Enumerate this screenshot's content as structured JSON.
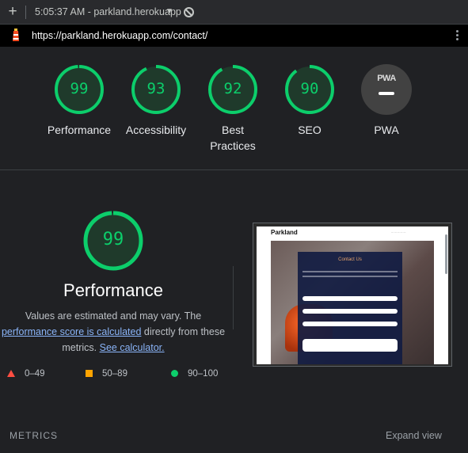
{
  "toolbar": {
    "new_tab_glyph": "+",
    "timestamp": "5:05:37 AM - parkland.herokuapp",
    "dropdown_glyph": "▼"
  },
  "urlbar": {
    "url": "https://parkland.herokuapp.com/contact/"
  },
  "categories": [
    {
      "label": "Performance",
      "score": "99",
      "fraction": 0.99
    },
    {
      "label": "Accessibility",
      "score": "93",
      "fraction": 0.93
    },
    {
      "label": "Best Practices",
      "score": "92",
      "fraction": 0.92
    },
    {
      "label": "SEO",
      "score": "90",
      "fraction": 0.9
    },
    {
      "label": "PWA",
      "badge": "PWA"
    }
  ],
  "performance": {
    "score": "99",
    "fraction": 0.99,
    "title": "Performance",
    "desc_1": "Values are estimated and may vary. The",
    "link_1": "performance score is calculated",
    "desc_2": " directly from these",
    "desc_3": "metrics. ",
    "link_2": "See calculator."
  },
  "legend": {
    "fail": "0–49",
    "average": "50–89",
    "pass": "90–100"
  },
  "thumbnail": {
    "brand": "Parkland",
    "form_title": "Contact Us"
  },
  "footer": {
    "metrics_label": "METRICS",
    "expand_label": "Expand view"
  },
  "colors": {
    "pass": "#0cce6b",
    "average": "#ffa400",
    "fail": "#ff4e42",
    "link": "#8ab4f8"
  },
  "icons": {
    "new_tab": "plus-icon",
    "block": "block-icon",
    "site": "lighthouse-icon",
    "menu": "kebab-menu-icon"
  }
}
